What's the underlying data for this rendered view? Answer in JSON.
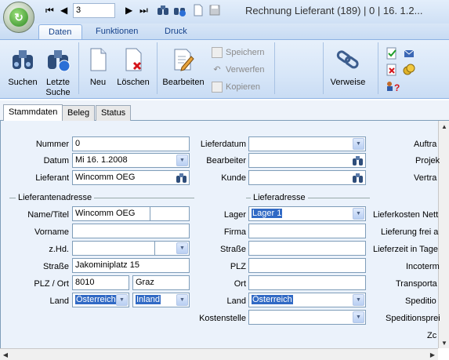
{
  "window": {
    "title": "Rechnung Lieferant  (189) | 0 | 16.  1.2...",
    "record_number": "3"
  },
  "ribbon_tabs": [
    "Daten",
    "Funktionen",
    "Druck"
  ],
  "ribbon": {
    "suchen": "Suchen",
    "letzte_suche_1": "Letzte",
    "letzte_suche_2": "Suche",
    "neu": "Neu",
    "loeschen": "Löschen",
    "bearbeiten": "Bearbeiten",
    "speichern": "Speichern",
    "verwerfen": "Verwerfen",
    "kopieren": "Kopieren",
    "verweise": "Verweise"
  },
  "sheet_tabs": [
    "Stammdaten",
    "Beleg",
    "Status"
  ],
  "form": {
    "nummer_label": "Nummer",
    "nummer_value": "0",
    "datum_label": "Datum",
    "datum_value": "Mi 16.  1.2008",
    "lieferant_label": "Lieferant",
    "lieferant_value": "Wincomm OEG",
    "lieferdatum_label": "Lieferdatum",
    "bearbeiter_label": "Bearbeiter",
    "kunde_label": "Kunde",
    "right_labels": [
      "Auftra",
      "Projek",
      "Vertra"
    ],
    "lieferantenadresse_title": "Lieferantenadresse",
    "lieferadresse_title": "Lieferadresse",
    "name_label": "Name/Titel",
    "name_value": "Wincomm OEG",
    "vorname_label": "Vorname",
    "zhd_label": "z.Hd.",
    "strasse_label": "Straße",
    "strasse_value": "Jakominiplatz 15",
    "plzort_label": "PLZ / Ort",
    "plz_value": "8010",
    "ort_value": "Graz",
    "land_label": "Land",
    "land_value": "Österreich",
    "inland_value": "Inland",
    "lager_label": "Lager",
    "lager_value": "Lager 1",
    "firma_label": "Firma",
    "la_strasse_label": "Straße",
    "la_plz_label": "PLZ",
    "la_ort_label": "Ort",
    "la_land_label": "Land",
    "la_land_value": "Österreich",
    "kostenstelle_label": "Kostenstelle",
    "far_right_labels": [
      "Lieferkosten Nett",
      "Lieferung frei a",
      "Lieferzeit in Tage",
      "Incoterm",
      "Transporta",
      "Speditio",
      "Speditionsprei",
      "Zc"
    ]
  }
}
